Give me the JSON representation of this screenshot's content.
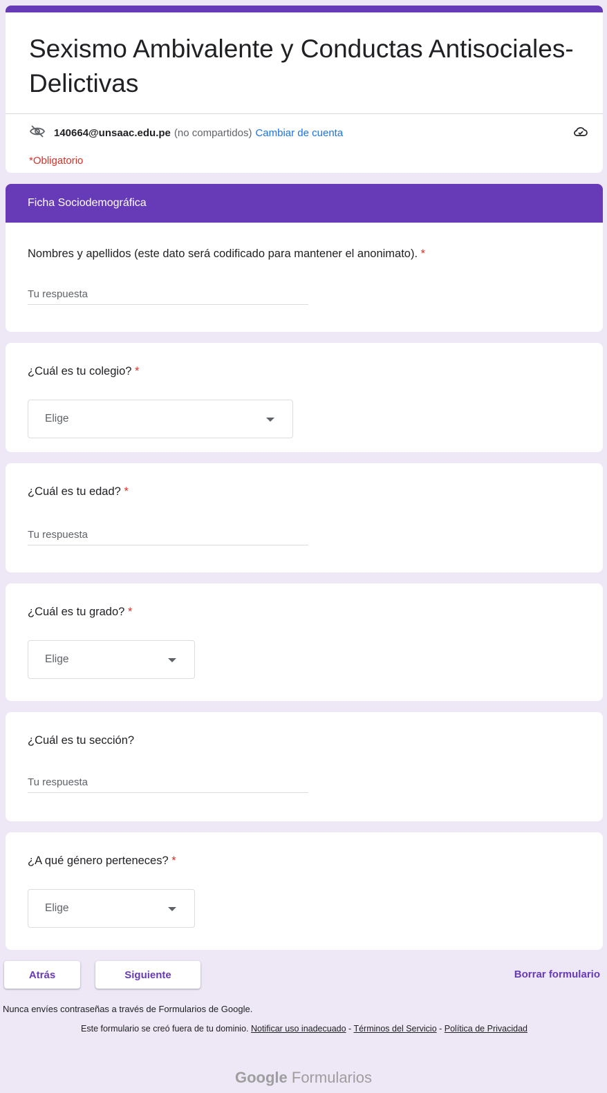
{
  "form": {
    "title": "Sexismo Ambivalente y Conductas Antisociales-Delictivas",
    "account_email": "140664@unsaac.edu.pe",
    "not_shared": "(no compartidos)",
    "switch_account": "Cambiar de cuenta",
    "required_note": "*Obligatorio"
  },
  "section": {
    "title": "Ficha Sociodemográfica"
  },
  "questions": [
    {
      "label": "Nombres y apellidos (este dato será codificado para mantener el anonimato).",
      "required": "*",
      "placeholder": "Tu respuesta"
    },
    {
      "label": "¿Cuál es tu colegio?",
      "required": "*",
      "select_value": "Elige"
    },
    {
      "label": "¿Cuál es tu edad?",
      "required": "*",
      "placeholder": "Tu respuesta"
    },
    {
      "label": "¿Cuál es tu grado?",
      "required": "*",
      "select_value": "Elige"
    },
    {
      "label": "¿Cuál es tu sección?",
      "placeholder": "Tu respuesta"
    },
    {
      "label": "¿A qué género perteneces?",
      "required": "*",
      "select_value": "Elige"
    }
  ],
  "nav": {
    "back": "Atrás",
    "next": "Siguiente",
    "clear": "Borrar formulario"
  },
  "footer": {
    "password_warning": "Nunca envíes contraseñas a través de Formularios de Google.",
    "created_outside": "Este formulario se creó fuera de tu dominio.",
    "report": "Notificar uso inadecuado",
    "sep1": " - ",
    "terms": "Términos del Servicio",
    "sep2": " - ",
    "privacy": "Política de Privacidad",
    "brand_bold": "Google",
    "brand_rest": "Formularios"
  },
  "colors": {
    "accent": "#673ab7",
    "background": "#ede7f6",
    "required": "#d93025",
    "link": "#1a73e8"
  },
  "icons": [
    "eye-off-icon",
    "cloud-done-icon",
    "dropdown-caret-icon"
  ]
}
